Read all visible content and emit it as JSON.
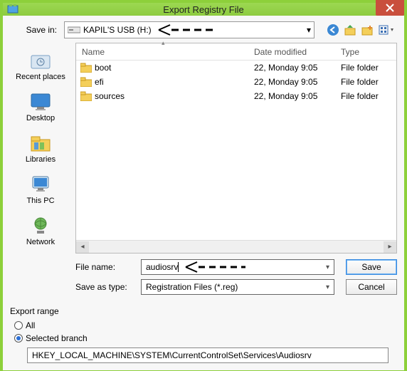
{
  "window": {
    "title": "Export Registry File"
  },
  "toolbar": {
    "save_in_label": "Save in:",
    "drive_label": "KAPIL'S USB (H:)",
    "back_icon": "back-icon",
    "up_icon": "up-folder-icon",
    "new_icon": "new-folder-icon",
    "view_icon": "views-icon"
  },
  "places": [
    {
      "label": "Recent places"
    },
    {
      "label": "Desktop"
    },
    {
      "label": "Libraries"
    },
    {
      "label": "This PC"
    },
    {
      "label": "Network"
    }
  ],
  "columns": {
    "name": "Name",
    "date": "Date modified",
    "type": "Type"
  },
  "files": [
    {
      "name": "boot",
      "date": "22, Monday 9:05",
      "type": "File folder"
    },
    {
      "name": "efi",
      "date": "22, Monday 9:05",
      "type": "File folder"
    },
    {
      "name": "sources",
      "date": "22, Monday 9:05",
      "type": "File folder"
    }
  ],
  "fields": {
    "file_name_label": "File name:",
    "file_name_value": "audiosrv",
    "save_as_type_label": "Save as type:",
    "save_as_type_value": "Registration Files (*.reg)",
    "save_btn": "Save",
    "cancel_btn": "Cancel"
  },
  "export_range": {
    "legend": "Export range",
    "all_label": "All",
    "selected_label": "Selected branch",
    "branch_path": "HKEY_LOCAL_MACHINE\\SYSTEM\\CurrentControlSet\\Services\\Audiosrv"
  },
  "annotations": {
    "arrow_glyph": "< – –",
    "arrow_glyph2": "< – – –"
  }
}
